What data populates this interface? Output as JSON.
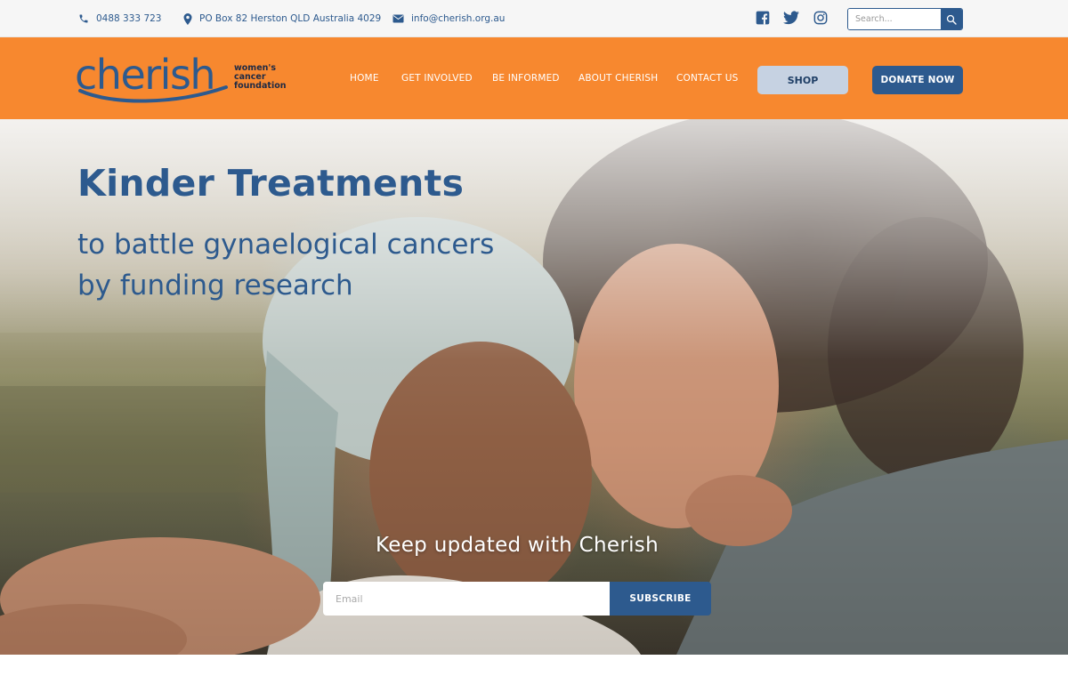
{
  "topbar": {
    "phone": "0488 333 723",
    "address": "PO Box 82 Herston QLD Australia 4029",
    "email": "info@cherish.org.au",
    "social": [
      "facebook-icon",
      "twitter-icon",
      "instagram-icon"
    ],
    "search_placeholder": "Search..."
  },
  "brand": {
    "name": "cherish",
    "tagline_line1": "women's",
    "tagline_line2": "cancer",
    "tagline_line3": "foundation"
  },
  "nav": {
    "items": [
      {
        "label": "HOME"
      },
      {
        "label": "GET INVOLVED"
      },
      {
        "label": "BE INFORMED"
      },
      {
        "label": "ABOUT CHERISH"
      },
      {
        "label": "CONTACT US"
      }
    ],
    "shop_label": "SHOP",
    "donate_label": "DONATE NOW"
  },
  "hero": {
    "title": "Kinder Treatments",
    "subtitle_line1": "to battle gynaelogical cancers",
    "subtitle_line2": "by funding research"
  },
  "newsletter": {
    "title": "Keep updated with Cherish",
    "email_placeholder": "Email",
    "subscribe_label": "SUBSCRIBE"
  },
  "colors": {
    "brand_blue": "#2d5a8e",
    "brand_orange": "#f7882f",
    "shop_button": "#c6d2e2"
  }
}
